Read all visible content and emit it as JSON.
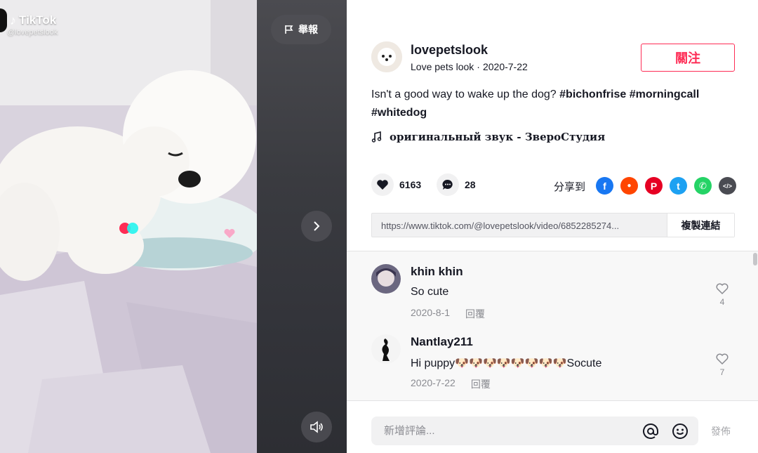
{
  "video": {
    "watermark_brand": "TikTok",
    "watermark_user": "@lovepetslook",
    "report_label": "舉報",
    "icons": {
      "report": "flag-icon",
      "next": "chevron-right-icon",
      "volume": "volume-icon"
    }
  },
  "author": {
    "username": "lovepetslook",
    "display_name": "Love pets look",
    "separator": "·",
    "date": "2020-7-22",
    "follow_label": "關注"
  },
  "post": {
    "caption_text": "Isn't a good way to wake up the dog?",
    "hashtags": [
      "#bichonfrise",
      "#morningcall",
      "#whitedog"
    ],
    "music": "оригинальный звук - ЗвероСтудия",
    "likes": "6163",
    "comments_count": "28"
  },
  "share": {
    "label": "分享到",
    "targets": [
      {
        "name": "facebook",
        "color": "#1877f2",
        "glyph": "f"
      },
      {
        "name": "reddit",
        "color": "#ff4500",
        "glyph": "●"
      },
      {
        "name": "pinterest",
        "color": "#e60023",
        "glyph": "P"
      },
      {
        "name": "twitter",
        "color": "#1da1f2",
        "glyph": "t"
      },
      {
        "name": "whatsapp",
        "color": "#25d366",
        "glyph": "✆"
      },
      {
        "name": "embed",
        "color": "#4a4b52",
        "glyph": "</>"
      }
    ],
    "link": "https://www.tiktok.com/@lovepetslook/video/6852285274...",
    "copy_label": "複製連結"
  },
  "comments": [
    {
      "user": "khin khin",
      "text": "So cute",
      "date": "2020-8-1",
      "reply_label": "回覆",
      "likes": "4"
    },
    {
      "user": "Nantlay211",
      "text_prefix": "Hi puppy",
      "emoji": "🐶",
      "emoji_count": 8,
      "text_suffix": "Socute",
      "date": "2020-7-22",
      "reply_label": "回覆",
      "likes": "7"
    }
  ],
  "composer": {
    "placeholder": "新增評論...",
    "post_label": "發佈",
    "icons": {
      "mention": "at-icon",
      "emoji": "smiley-icon"
    }
  },
  "colors": {
    "accent": "#fe2c55",
    "muted": "#8a8b91"
  }
}
